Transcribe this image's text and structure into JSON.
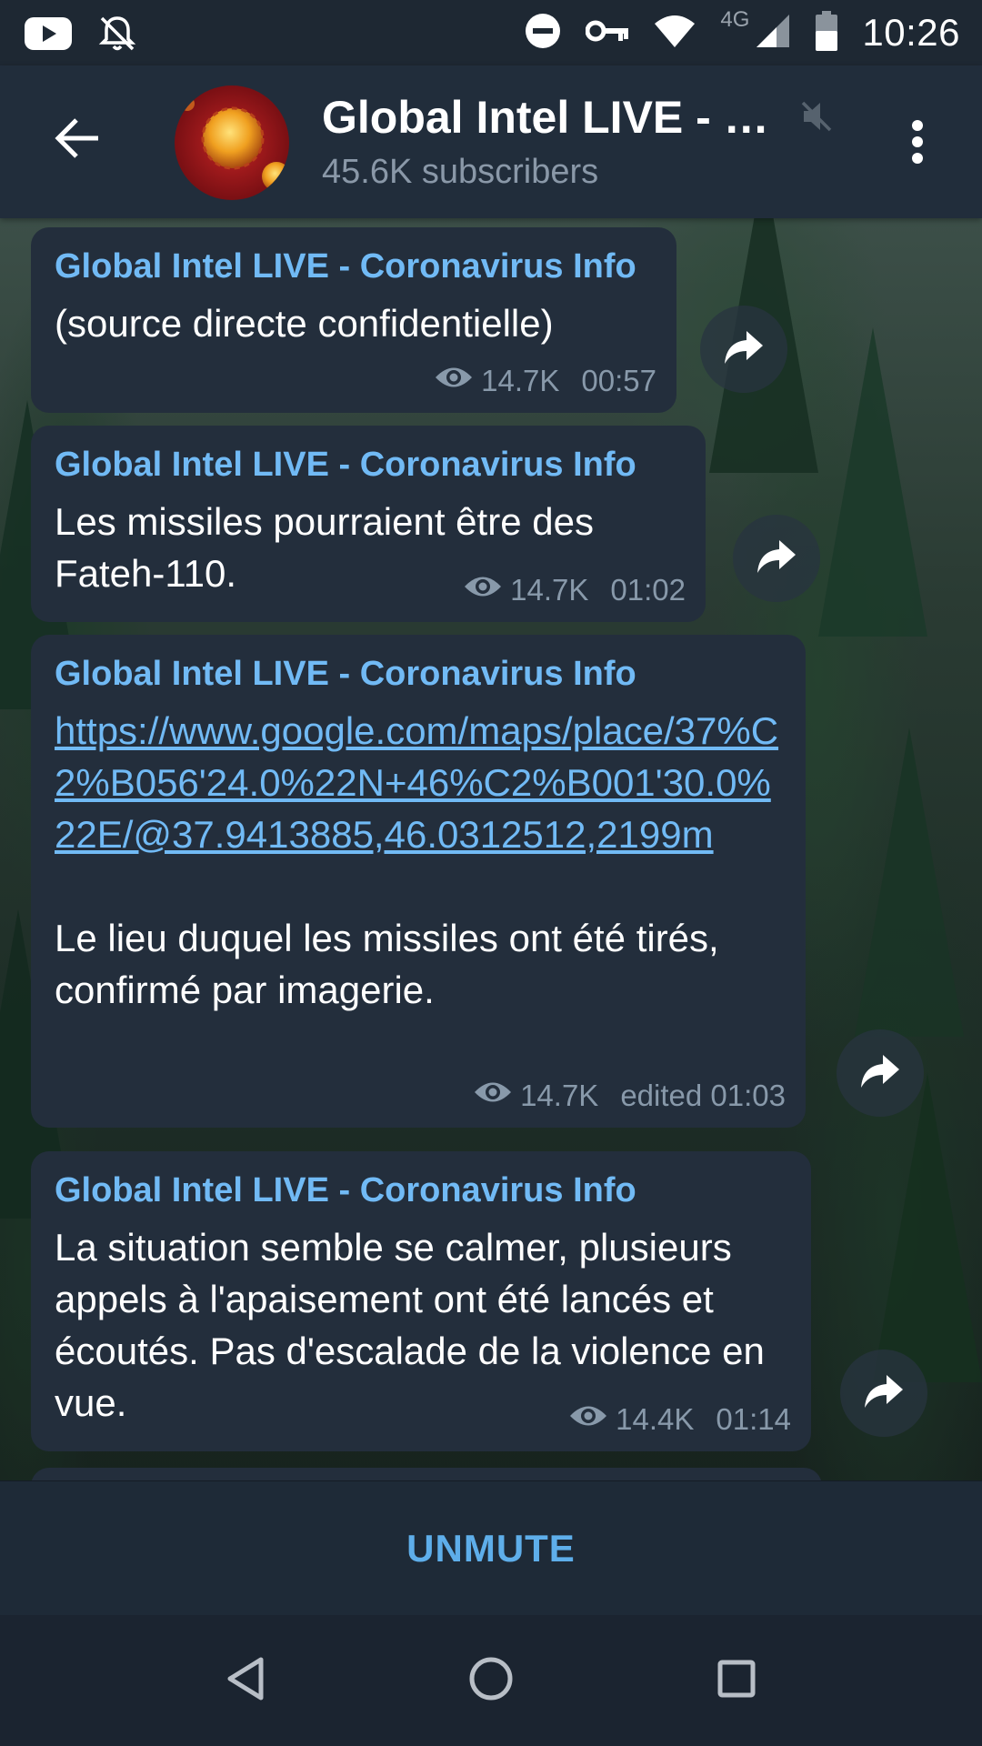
{
  "status_bar": {
    "time": "10:26",
    "network": "4G",
    "icons": [
      "youtube-icon",
      "notifications-off-icon",
      "do-not-disturb-icon",
      "vpn-key-icon",
      "wifi-icon",
      "cell-signal-icon",
      "battery-icon"
    ]
  },
  "header": {
    "title": "Global Intel LIVE - C…",
    "subtitle": "45.6K subscribers",
    "muted": true
  },
  "messages": [
    {
      "author": "Global Intel LIVE - Coronavirus Info",
      "text": "(source directe confidentielle)",
      "views": "14.7K",
      "time": "00:57"
    },
    {
      "author": "Global Intel LIVE - Coronavirus Info",
      "text": "Les missiles pourraient être des Fateh-110.",
      "views": "14.7K",
      "time": "01:02"
    },
    {
      "author": "Global Intel LIVE - Coronavirus Info",
      "link": "https://www.google.com/maps/place/37%C2%B056'24.0%22N+46%C2%B001'30.0%22E/@37.9413885,46.0312512,2199m",
      "text": "Le lieu duquel les missiles ont été tirés, confirmé par imagerie.",
      "views": "14.7K",
      "time": "edited 01:03"
    },
    {
      "author": "Global Intel LIVE - Coronavirus Info",
      "text": "La situation semble se calmer, plusieurs appels à l'apaisement ont été lancés et écoutés. Pas d'escalade de la violence en vue.",
      "views": "14.4K",
      "time": "01:14"
    }
  ],
  "bottom_bar": {
    "unmute_label": "UNMUTE"
  },
  "colors": {
    "accent": "#71baf5",
    "bubble": "#232e3c",
    "header": "#212d3b"
  }
}
